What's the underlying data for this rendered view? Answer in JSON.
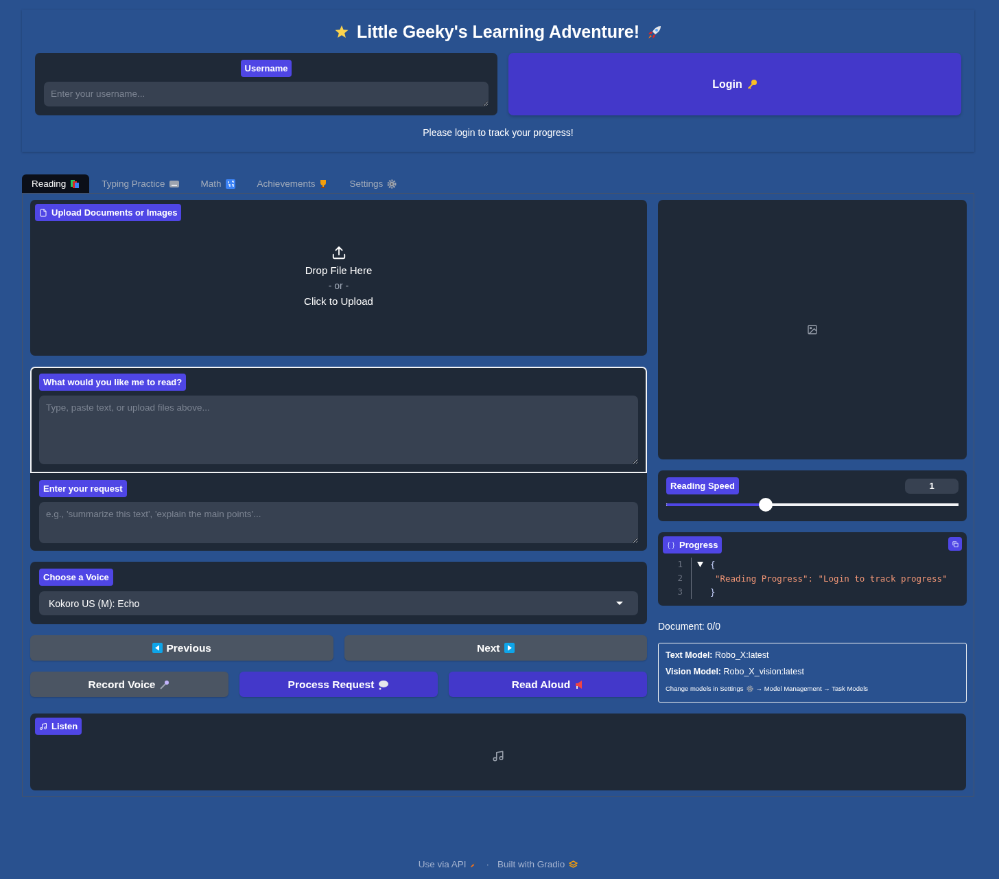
{
  "header": {
    "title": "Little Geeky's Learning Adventure!",
    "username": {
      "label": "Username",
      "placeholder": "Enter your username..."
    },
    "login_button": "Login",
    "status": "Please login to track your progress!"
  },
  "tabs": [
    {
      "label": "Reading",
      "selected": true
    },
    {
      "label": "Typing Practice",
      "selected": false
    },
    {
      "label": "Math",
      "selected": false
    },
    {
      "label": "Achievements",
      "selected": false
    },
    {
      "label": "Settings",
      "selected": false
    }
  ],
  "upload": {
    "label": "Upload Documents or Images",
    "drop": "Drop File Here",
    "or": "- or -",
    "click": "Click to Upload"
  },
  "read_text": {
    "label": "What would you like me to read?",
    "placeholder": "Type, paste text, or upload files above...",
    "focused": true
  },
  "request": {
    "label": "Enter your request",
    "placeholder": "e.g., 'summarize this text', 'explain the main points'..."
  },
  "voice": {
    "label": "Choose a Voice",
    "value": "Kokoro US (M): Echo"
  },
  "nav_buttons": [
    {
      "label": "Previous",
      "kind": "secondary"
    },
    {
      "label": "Next",
      "kind": "secondary"
    }
  ],
  "action_buttons": [
    {
      "label": "Record Voice",
      "kind": "secondary"
    },
    {
      "label": "Process Request",
      "kind": "primary"
    },
    {
      "label": "Read Aloud",
      "kind": "primary"
    }
  ],
  "speed": {
    "label": "Reading Speed",
    "value": "1",
    "level": 0.34
  },
  "progress": {
    "label": "Progress",
    "lines": [
      {
        "number": "1",
        "kind": "open",
        "text": "{"
      },
      {
        "number": "2",
        "kind": "entry",
        "key": "\"Reading Progress\"",
        "separator": ": ",
        "value": "\"Login to track progress\""
      },
      {
        "number": "3",
        "kind": "close",
        "text": "}"
      }
    ]
  },
  "document": "Document: 0/0",
  "models": {
    "text_model": {
      "label": "Text Model:",
      "value": "Robo_X:latest"
    },
    "vision_model": {
      "label": "Vision Model:",
      "value": "Robo_X_vision:latest"
    },
    "hint_start": "Change models in Settings",
    "hint_end": "→ Model Management → Task Models"
  },
  "listen": {
    "label": "Listen"
  },
  "footer": {
    "api": "Use via API",
    "separator": "·",
    "built": "Built with Gradio"
  }
}
